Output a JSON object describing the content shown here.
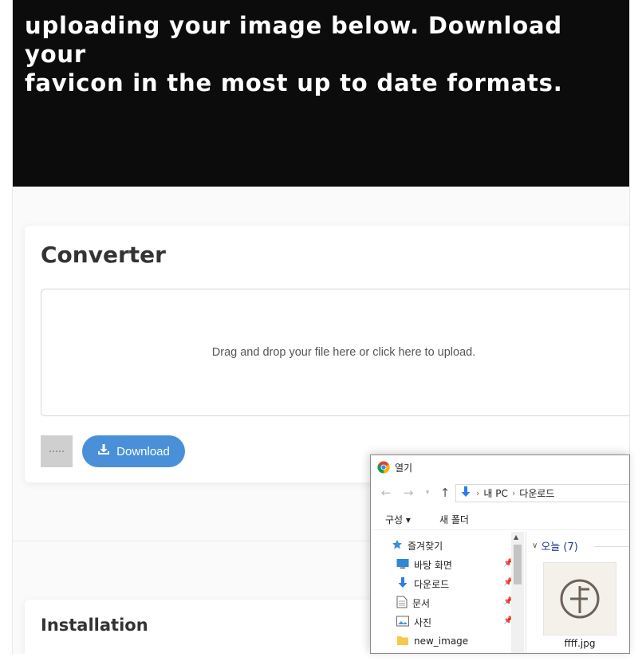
{
  "hero": {
    "line1": "uploading your image below. Download your",
    "line2": "favicon in the most up to date formats."
  },
  "converter": {
    "title": "Converter",
    "dropzone_text": "Drag and drop your file here or click here to upload.",
    "download_label": "Download"
  },
  "installation": {
    "title": "Installation"
  },
  "dialog": {
    "title": "열기",
    "breadcrumb": [
      "내 PC",
      "다운로드"
    ],
    "toolbar": {
      "organize": "구성 ▾",
      "new_folder": "새 폴더"
    },
    "nav_items": [
      {
        "label": "즐겨찾기",
        "icon": "star-icon"
      },
      {
        "label": "바탕 화면",
        "icon": "desktop-icon"
      },
      {
        "label": "다운로드",
        "icon": "download-folder-icon"
      },
      {
        "label": "문서",
        "icon": "document-icon"
      },
      {
        "label": "사진",
        "icon": "picture-icon"
      },
      {
        "label": "new_image",
        "icon": "folder-icon"
      }
    ],
    "group_header": "오늘 (7)",
    "file": {
      "name": "ffff.jpg"
    }
  },
  "colors": {
    "hero_bg": "#0c0c0c",
    "button_blue": "#4a90d9",
    "group_text": "#1e3a8a"
  }
}
